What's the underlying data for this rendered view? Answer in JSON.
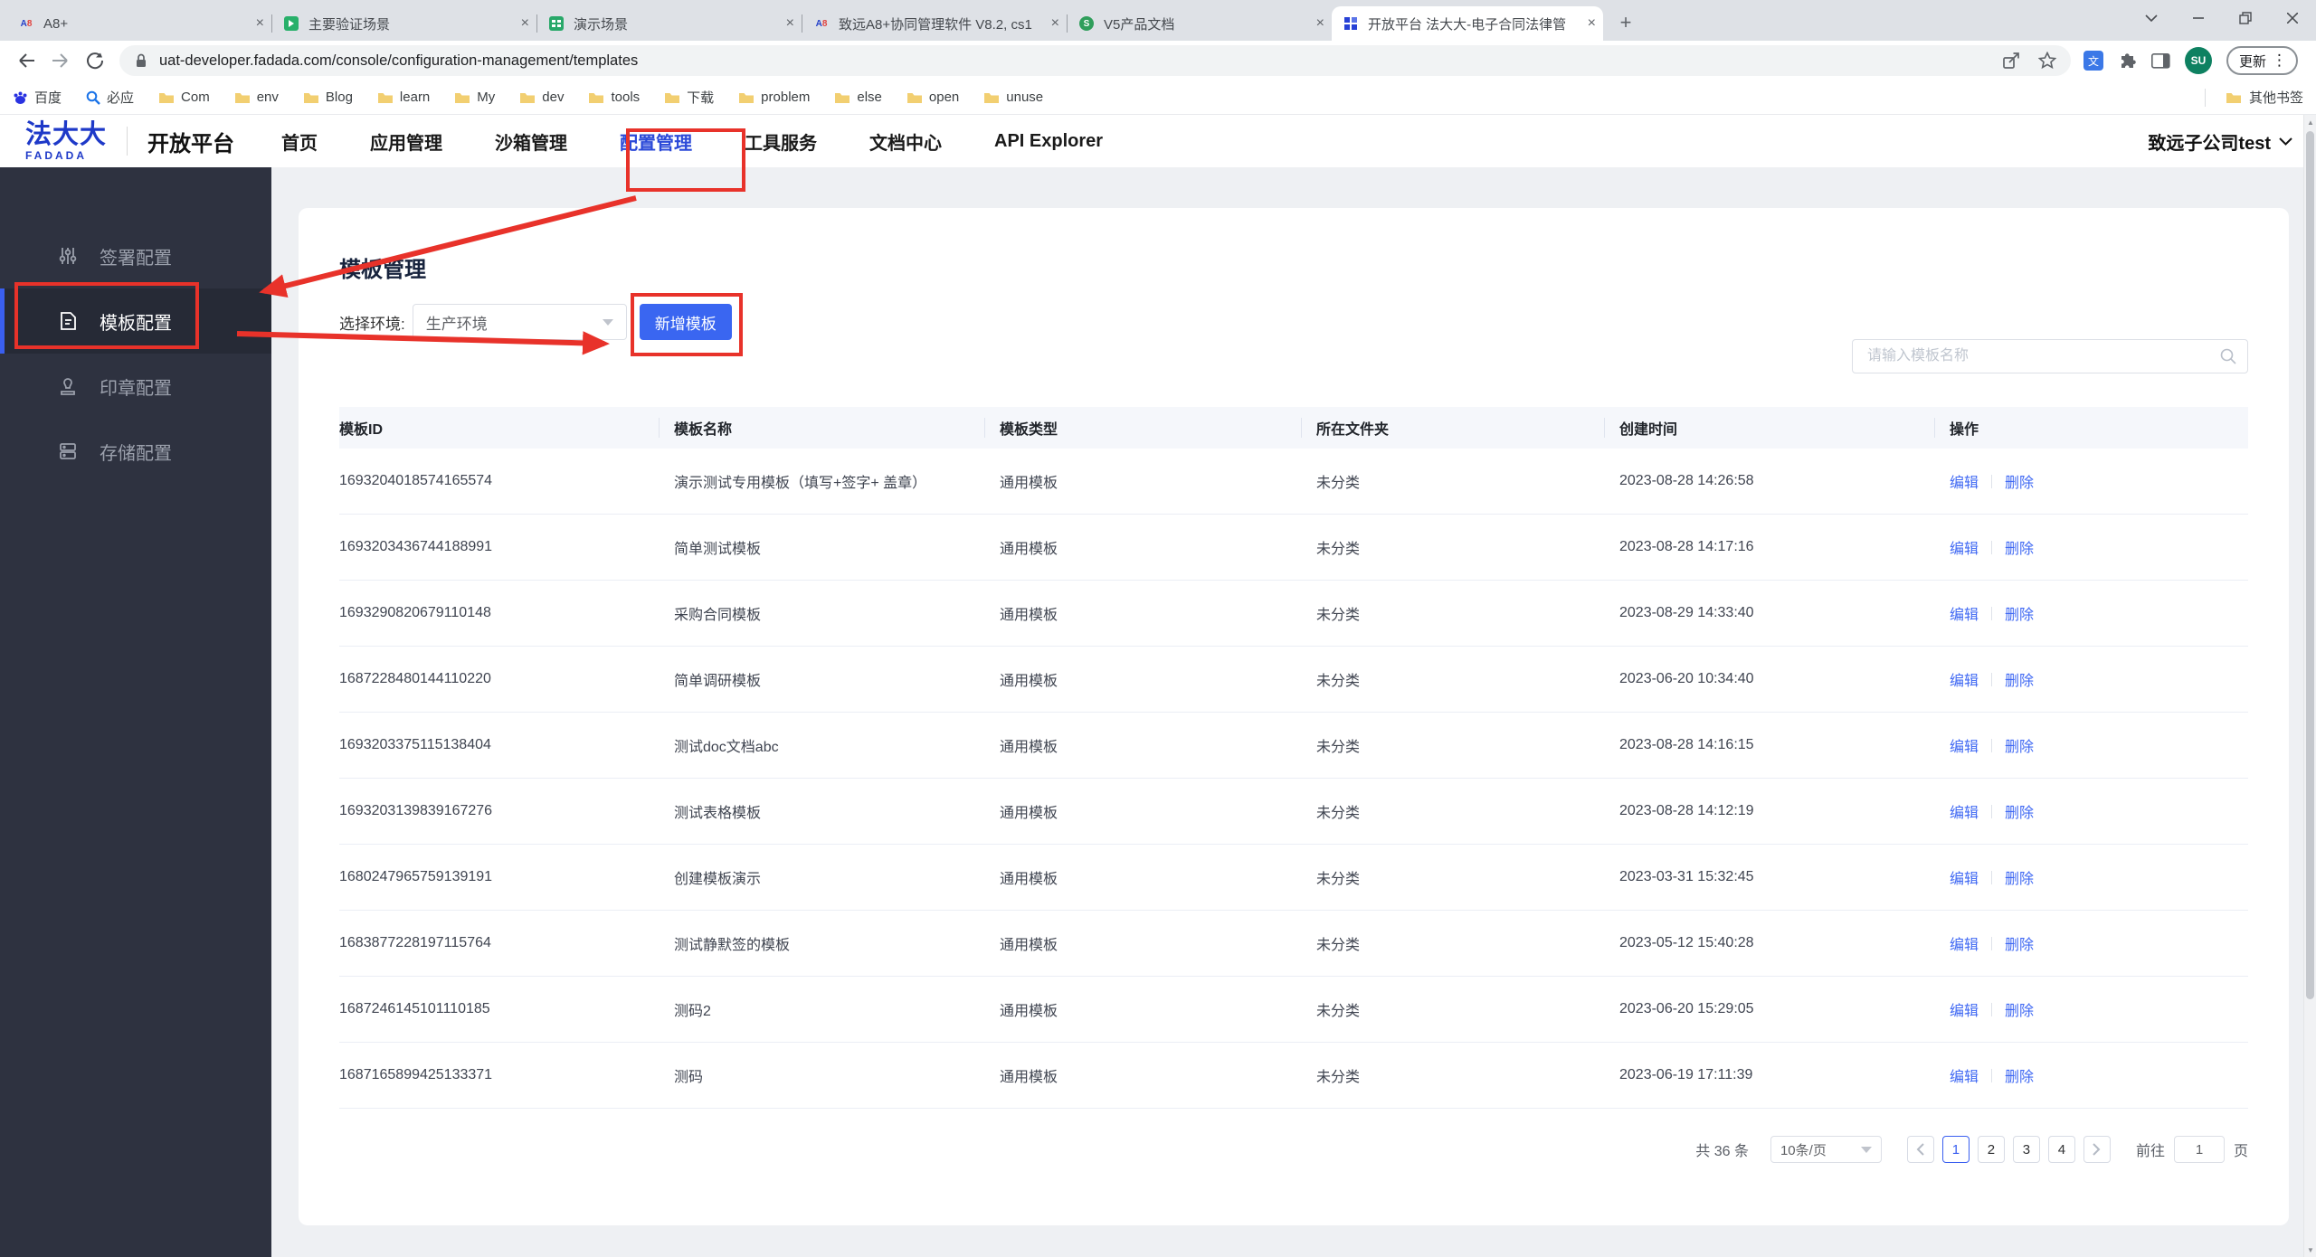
{
  "browser": {
    "tabs": [
      {
        "title": "A8+",
        "icon": "a8-logo-icon",
        "active": false
      },
      {
        "title": "主要验证场景",
        "icon": "green-doc-icon",
        "active": false
      },
      {
        "title": "演示场景",
        "icon": "green-sheet-icon",
        "active": false
      },
      {
        "title": "致远A8+协同管理软件 V8.2, cs1",
        "icon": "a8-logo-icon",
        "active": false
      },
      {
        "title": "V5产品文档",
        "icon": "green-circle-icon",
        "active": false
      },
      {
        "title": "开放平台 法大大-电子合同法律管",
        "icon": "blue-grid-icon",
        "active": true
      }
    ],
    "url": "uat-developer.fadada.com/console/configuration-management/templates",
    "avatar_text": "SU",
    "update_label": "更新"
  },
  "bookmarks": {
    "baidu": "百度",
    "bing": "必应",
    "folders": [
      "Com",
      "env",
      "Blog",
      "learn",
      "My",
      "dev",
      "tools",
      "下载",
      "problem",
      "else",
      "open",
      "unuse"
    ],
    "other": "其他书签"
  },
  "nav": {
    "logo_main": "法大大",
    "logo_sub": "FADADA",
    "platform": "开放平台",
    "items": [
      {
        "label": "首页",
        "active": false
      },
      {
        "label": "应用管理",
        "active": false
      },
      {
        "label": "沙箱管理",
        "active": false
      },
      {
        "label": "配置管理",
        "active": true
      },
      {
        "label": "工具服务",
        "active": false
      },
      {
        "label": "文档中心",
        "active": false
      },
      {
        "label": "API Explorer",
        "active": false
      }
    ],
    "account": "致远子公司test"
  },
  "sidebar": {
    "items": [
      {
        "label": "签署配置",
        "icon": "sliders-icon",
        "active": false
      },
      {
        "label": "模板配置",
        "icon": "document-icon",
        "active": true
      },
      {
        "label": "印章配置",
        "icon": "stamp-icon",
        "active": false
      },
      {
        "label": "存储配置",
        "icon": "storage-icon",
        "active": false
      }
    ]
  },
  "main": {
    "title": "模板管理",
    "env_label": "选择环境:",
    "env_value": "生产环境",
    "add_button": "新增模板",
    "search_placeholder": "请输入模板名称",
    "table": {
      "headers": [
        "模板ID",
        "模板名称",
        "模板类型",
        "所在文件夹",
        "创建时间",
        "操作"
      ],
      "edit_label": "编辑",
      "delete_label": "删除",
      "rows": [
        {
          "id": "1693204018574165574",
          "name": "演示测试专用模板（填写+签字+ 盖章）",
          "type": "通用模板",
          "folder": "未分类",
          "created": "2023-08-28 14:26:58"
        },
        {
          "id": "1693203436744188991",
          "name": "简单测试模板",
          "type": "通用模板",
          "folder": "未分类",
          "created": "2023-08-28 14:17:16"
        },
        {
          "id": "1693290820679110148",
          "name": "采购合同模板",
          "type": "通用模板",
          "folder": "未分类",
          "created": "2023-08-29 14:33:40"
        },
        {
          "id": "1687228480144110220",
          "name": "简单调研模板",
          "type": "通用模板",
          "folder": "未分类",
          "created": "2023-06-20 10:34:40"
        },
        {
          "id": "1693203375115138404",
          "name": "测试doc文档abc",
          "type": "通用模板",
          "folder": "未分类",
          "created": "2023-08-28 14:16:15"
        },
        {
          "id": "1693203139839167276",
          "name": "测试表格模板",
          "type": "通用模板",
          "folder": "未分类",
          "created": "2023-08-28 14:12:19"
        },
        {
          "id": "1680247965759139191",
          "name": "创建模板演示",
          "type": "通用模板",
          "folder": "未分类",
          "created": "2023-03-31 15:32:45"
        },
        {
          "id": "1683877228197115764",
          "name": "测试静默签的模板",
          "type": "通用模板",
          "folder": "未分类",
          "created": "2023-05-12 15:40:28"
        },
        {
          "id": "1687246145101110185",
          "name": "测码2",
          "type": "通用模板",
          "folder": "未分类",
          "created": "2023-06-20 15:29:05"
        },
        {
          "id": "1687165899425133371",
          "name": "测码",
          "type": "通用模板",
          "folder": "未分类",
          "created": "2023-06-19 17:11:39"
        }
      ]
    },
    "pagination": {
      "total": "共 36 条",
      "page_size": "10条/页",
      "pages": [
        "1",
        "2",
        "3",
        "4"
      ],
      "current_page": "1",
      "goto_label": "前往",
      "goto_value": "1",
      "page_unit": "页"
    }
  },
  "colors": {
    "accent_blue": "#3a66f1",
    "link_blue": "#3f68f3",
    "annotation_red": "#e8322a",
    "sidebar_bg": "#2e3240",
    "avatar_green": "#0e8161"
  }
}
